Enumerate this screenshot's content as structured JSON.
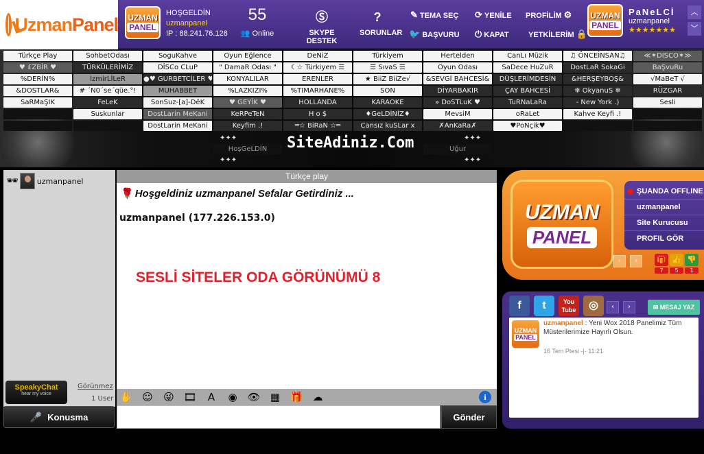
{
  "brand": {
    "logo_text_a": "Uzman",
    "logo_text_b": "Panel",
    "badge_top": "UZMAN",
    "badge_bottom": "PANEL"
  },
  "header": {
    "greeting": "HOŞGELDİN",
    "username": "uzmanpanel",
    "ip": "IP : 88.241.76.128",
    "online_count": "55",
    "online_label": "Online",
    "skype_label": "SKYPE DESTEK",
    "sorunlar_label": "SORUNLAR",
    "tema_label": "TEMA SEÇ",
    "basvuru_label": "BAŞVURU",
    "yenile_label": "YENİLE",
    "kapat_label": "KAPAT",
    "profilim_label": "PROFİLİM",
    "yetkililerim_label": "YETKİLERİM",
    "right_name": "PaNeLCİ",
    "right_sub": "uzmanpanel",
    "stars": "★★★★★★★"
  },
  "rooms": [
    [
      "Türkçe Play",
      "SohbetOdası",
      "SoguKahve",
      "Oyun Eğlence",
      "DeNiZ",
      "Türkiyem",
      "Hertelden",
      "CanLı Müzik",
      "♫ ÖNCEİNSAN♫",
      "≪✶DISCO✶≫"
    ],
    [
      "♥ £ZBİR ♥",
      "TÜRKÜLERİMİZ",
      "DİSCo CLuP",
      "\" DamaR Odası \"",
      "☾☆ Türkiyem ☰",
      "☰ SıvaS ☰",
      "Oyun Odası",
      "SaDece HuZuR",
      "DostLaR SokaGi",
      "BaŞvuRu"
    ],
    [
      "%DERİN%",
      "İzmirLİLeR",
      "●♥ GURBETCİLER ♥●",
      "KONYALILAR",
      "ERENLER",
      "★ BiiZ BiiZe√",
      "&SEVGİ BAHCESİ&",
      "DÜŞLERİMDESİN",
      "&HERŞEYBOŞ&",
      "√MaBeT √"
    ],
    [
      "&DOSTLAR&",
      "# ´N0´se´qüe.°!",
      "MUHABBET",
      "%LAZKIZI%",
      "%TIMARHANE%",
      "SON",
      "DİYARBAKIR",
      "ÇAY BAHCESİ",
      "❄ OkyanuS ❄",
      "RÜZGAR"
    ],
    [
      "SaRMaŞIK",
      "FeLeK",
      "SonSuz-[a]-DëK",
      "♥ GEYİK ♥",
      "HOLLANDA",
      "KARAOKE",
      "» DoSTLuK ♥",
      "TuRNaLaRa",
      "- New York .)",
      "Sesli"
    ],
    [
      "",
      "Suskunlar",
      "DostLarin MeKani",
      "KeRPeTeN",
      "H o $",
      "♦GeLDİNİZ♦",
      "MevsiM",
      "oRaLet",
      "Kahve Keyfi .!",
      ""
    ],
    [
      "",
      "",
      "DostLarin MeKani",
      "Keyfim .!",
      "═☆ BiRaN ☆═",
      "Cansız kuSLar x",
      "✗AnKaRa✗",
      "♥PoNçik♥",
      "",
      ""
    ]
  ],
  "site_name": "SiteAdiniz.Com",
  "hosgeldin_room": "HoşGeLDİN",
  "ugur_room": "Uğur",
  "left": {
    "username": "uzmanpanel",
    "logo_top": "SpeakyChat",
    "logo_bottom": "hear my voice",
    "gorunmez": "Görünmez",
    "user_count": "1 User",
    "talk_label": "Konusma"
  },
  "chat": {
    "room_title": "Türkçe play",
    "welcome": "Hoşgeldiniz uzmanpanel Sefalar Getirdiniz ...",
    "ip_line": "uzmanpanel (177.226.153.0)",
    "big_title": "SESLİ SİTELER ODA GÖRÜNÜMÜ 8",
    "send_label": "Gönder",
    "info_label": "i"
  },
  "profile": {
    "logo_top": "UZMAN",
    "logo_bottom": "PANEL",
    "status": "ŞUANDA OFFLINE",
    "name": "uzmanpanel",
    "role": "Site Kurucusu",
    "view_profile": "PROFIL GÖR",
    "gift_count": "7",
    "like_count": "5",
    "dislike_count": "1"
  },
  "social": {
    "message_btn": "MESAJ YAZ",
    "feed_author": "uzmanpanel",
    "feed_text": " : Yeni Wox 2018 Panelimiz Tüm Müsterilerimize Hayırlı Olsun.",
    "feed_time": "16 Tem Ptesi -|- 11:21"
  },
  "colors": {
    "header_bg": "#4a3290",
    "accent_orange": "#f07a1a",
    "title_red": "#e0202a"
  }
}
